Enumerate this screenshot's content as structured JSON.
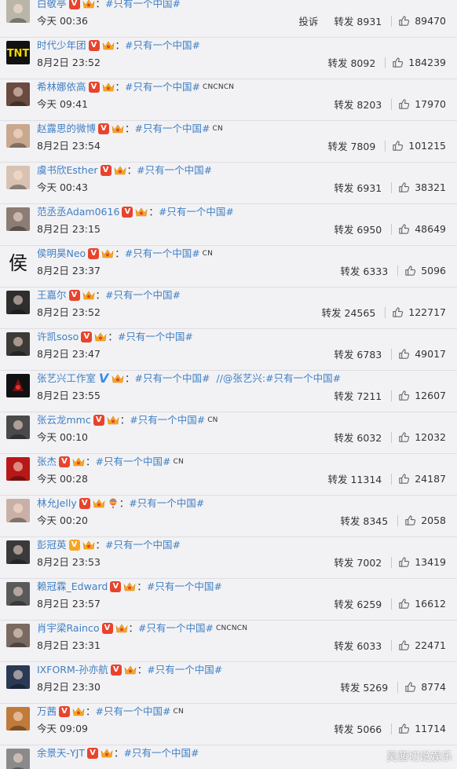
{
  "common": {
    "separator": "：",
    "report_label": "投诉",
    "forward_label": "转发",
    "tag": "#只有一个中国#"
  },
  "watermark": "吴茜切说娱乐",
  "colors": {
    "link": "#3f7fc2",
    "vip_badge": "#e8432d",
    "crown": "#f5a623"
  },
  "rows": [
    {
      "user": "白敬亭",
      "badge": "red-v",
      "crown": true,
      "extra": "",
      "suffix": "",
      "tail": "",
      "time": "今天 00:36",
      "report": true,
      "forwards": "8931",
      "likes": "89470",
      "avatar": {
        "kind": "photo",
        "color": "#b9b5a8"
      }
    },
    {
      "user": "时代少年团",
      "badge": "red-v",
      "crown": true,
      "extra": "",
      "suffix": "",
      "tail": "",
      "time": "8月2日 23:52",
      "report": false,
      "forwards": "8092",
      "likes": "184239",
      "avatar": {
        "kind": "logo",
        "color": "#111111"
      }
    },
    {
      "user": "希林娜依高",
      "badge": "red-v",
      "crown": true,
      "extra": "",
      "suffix": "CNCNCN",
      "tail": "",
      "time": "今天 09:41",
      "report": false,
      "forwards": "8203",
      "likes": "17970",
      "avatar": {
        "kind": "photo",
        "color": "#6b4a3f"
      }
    },
    {
      "user": "赵露思的微博",
      "badge": "red-v",
      "crown": true,
      "extra": "",
      "suffix": "CN",
      "tail": "",
      "time": "8月2日 23:54",
      "report": false,
      "forwards": "7809",
      "likes": "101215",
      "avatar": {
        "kind": "photo",
        "color": "#c9a890"
      }
    },
    {
      "user": "虞书欣Esther",
      "badge": "red-v",
      "crown": true,
      "extra": "",
      "suffix": "",
      "tail": "",
      "time": "今天 00:43",
      "report": false,
      "forwards": "6931",
      "likes": "38321",
      "avatar": {
        "kind": "photo",
        "color": "#d8c2b2"
      }
    },
    {
      "user": "范丞丞Adam0616",
      "badge": "red-v",
      "crown": true,
      "extra": "",
      "suffix": "",
      "tail": "",
      "time": "8月2日 23:15",
      "report": false,
      "forwards": "6950",
      "likes": "48649",
      "avatar": {
        "kind": "photo",
        "color": "#8b7d74"
      }
    },
    {
      "user": "侯明昊Neo",
      "badge": "red-v",
      "crown": true,
      "extra": "",
      "suffix": "CN",
      "tail": "",
      "time": "8月2日 23:37",
      "report": false,
      "forwards": "6333",
      "likes": "5096",
      "avatar": {
        "kind": "glyph",
        "text": "侯"
      }
    },
    {
      "user": "王嘉尔",
      "badge": "red-v",
      "crown": true,
      "extra": "",
      "suffix": "",
      "tail": "",
      "time": "8月2日 23:52",
      "report": false,
      "forwards": "24565",
      "likes": "122717",
      "avatar": {
        "kind": "photo",
        "color": "#2e2e2e"
      }
    },
    {
      "user": "许凯soso",
      "badge": "red-v",
      "crown": true,
      "extra": "",
      "suffix": "",
      "tail": "",
      "time": "8月2日 23:47",
      "report": false,
      "forwards": "6783",
      "likes": "49017",
      "avatar": {
        "kind": "photo",
        "color": "#3d3a38"
      }
    },
    {
      "user": "张艺兴工作室",
      "badge": "blue-v",
      "crown": true,
      "extra": "",
      "suffix": "",
      "tail": "//@张艺兴:#只有一个中国#",
      "time": "8月2日 23:55",
      "report": false,
      "forwards": "7211",
      "likes": "12607",
      "avatar": {
        "kind": "logo",
        "color": "#7a1010"
      }
    },
    {
      "user": "张云龙mmc",
      "badge": "red-v",
      "crown": true,
      "extra": "",
      "suffix": "CN",
      "tail": "",
      "time": "今天 00:10",
      "report": false,
      "forwards": "6032",
      "likes": "12032",
      "avatar": {
        "kind": "photo",
        "color": "#4a4a4a"
      }
    },
    {
      "user": "张杰",
      "badge": "red-v",
      "crown": true,
      "extra": "",
      "suffix": "CN",
      "tail": "",
      "time": "今天 00:28",
      "report": false,
      "forwards": "11314",
      "likes": "24187",
      "avatar": {
        "kind": "photo",
        "color": "#b81818"
      }
    },
    {
      "user": "林允Jelly",
      "badge": "red-v",
      "crown": true,
      "extra": "balloon",
      "suffix": "",
      "tail": "",
      "time": "今天 00:20",
      "report": false,
      "forwards": "8345",
      "likes": "2058",
      "avatar": {
        "kind": "photo",
        "color": "#c9b0a6"
      }
    },
    {
      "user": "彭冠英",
      "badge": "gold-v",
      "crown": true,
      "extra": "",
      "suffix": "",
      "tail": "",
      "time": "8月2日 23:53",
      "report": false,
      "forwards": "7002",
      "likes": "13419",
      "avatar": {
        "kind": "photo",
        "color": "#3a3a3a"
      }
    },
    {
      "user": "赖冠霖_Edward",
      "badge": "red-v",
      "crown": true,
      "extra": "",
      "suffix": "",
      "tail": "",
      "time": "8月2日 23:57",
      "report": false,
      "forwards": "6259",
      "likes": "16612",
      "avatar": {
        "kind": "photo",
        "color": "#5a5a5a"
      }
    },
    {
      "user": "肖宇梁Rainco",
      "badge": "red-v",
      "crown": true,
      "extra": "",
      "suffix": "CNCNCN",
      "tail": "",
      "time": "8月2日 23:31",
      "report": false,
      "forwards": "6033",
      "likes": "22471",
      "avatar": {
        "kind": "photo",
        "color": "#7a6a62"
      }
    },
    {
      "user": "IXFORM-孙亦航",
      "badge": "red-v",
      "crown": true,
      "extra": "",
      "suffix": "",
      "tail": "",
      "time": "8月2日 23:30",
      "report": false,
      "forwards": "5269",
      "likes": "8774",
      "avatar": {
        "kind": "photo",
        "color": "#2a3a55"
      }
    },
    {
      "user": "万茜",
      "badge": "red-v",
      "crown": true,
      "extra": "",
      "suffix": "CN",
      "tail": "",
      "time": "今天 09:09",
      "report": false,
      "forwards": "5066",
      "likes": "11714",
      "avatar": {
        "kind": "photo",
        "color": "#c07a3a"
      }
    },
    {
      "user": "余景天-YJT",
      "badge": "red-v",
      "crown": true,
      "extra": "",
      "suffix": "",
      "tail": "",
      "time": "",
      "report": false,
      "forwards": "",
      "likes": "",
      "avatar": {
        "kind": "photo",
        "color": "#8a8a8a"
      }
    }
  ]
}
